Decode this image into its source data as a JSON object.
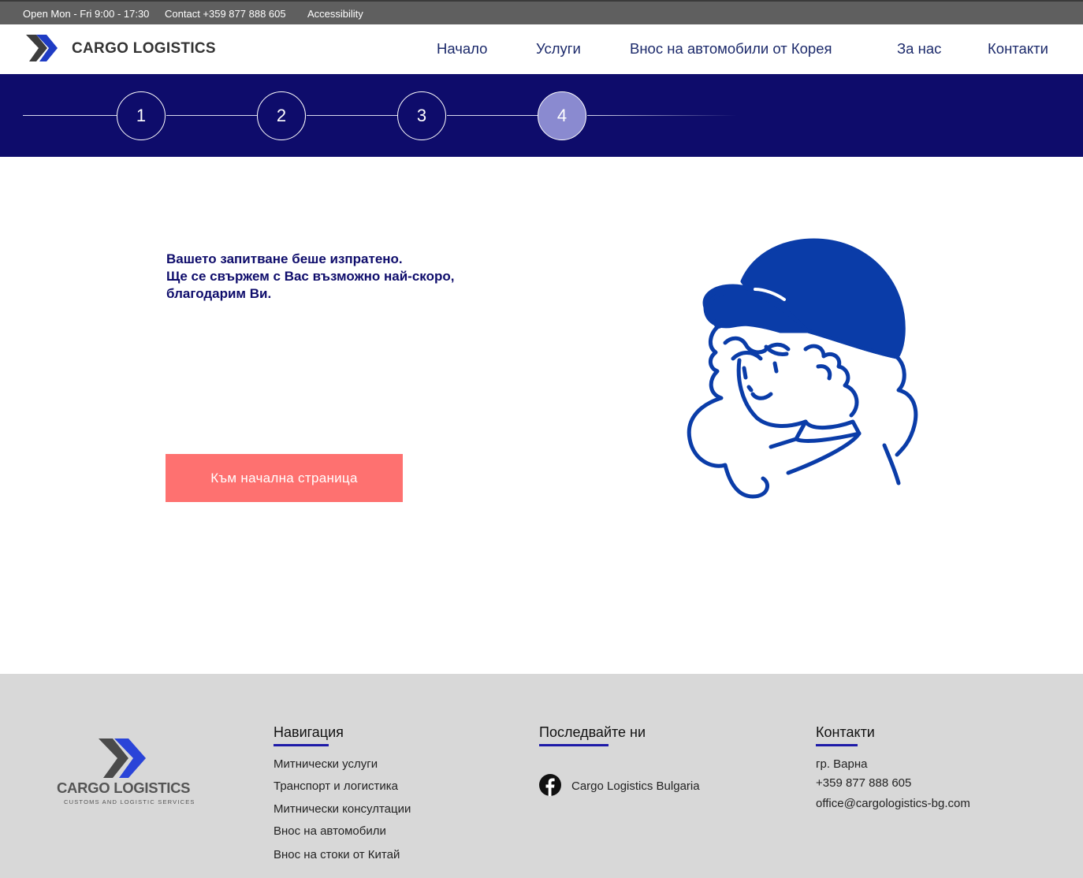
{
  "topbar": {
    "hours": "Open Mon - Fri 9:00 - 17:30",
    "contact": "Contact +359 877 888 605",
    "accessibility": "Accessibility"
  },
  "header": {
    "brand": "CARGO LOGISTICS",
    "nav": [
      "Начало",
      "Услуги",
      "Внос на автомобили от Корея",
      "За нас",
      "Контакти"
    ]
  },
  "stepper": {
    "steps": [
      "1",
      "2",
      "3",
      "4"
    ],
    "active_step": 4
  },
  "main": {
    "message_lines": [
      "Вашето запитване беше изпратено.",
      "Ще се свържем с Вас възможно най-скоро,",
      "благодарим Ви."
    ],
    "home_button": "Към начална страница"
  },
  "footer": {
    "logo_brand": "CARGO LOGISTICS",
    "logo_tagline": "CUSTOMS AND LOGISTIC SERVICES",
    "navigation": {
      "heading": "Навигация",
      "items": [
        "Митнически услуги",
        "Транспорт и логистика",
        "Митнически консултации",
        "Внос на автомобили",
        "Внос на стоки от Китай"
      ]
    },
    "follow": {
      "heading": "Последвайте ни",
      "facebook": "Cargo Logistics Bulgaria"
    },
    "contacts": {
      "heading": "Контакти",
      "city": "гр. Варна",
      "phone": "+359 877 888 605",
      "email": "office@cargologistics-bg.com"
    }
  },
  "colors": {
    "topbar": "#5f5f5f",
    "stepper_bg": "#0e0c6b",
    "active_step": "#8a8ad0",
    "button": "#fe7170",
    "illustration": "#0a3ca8",
    "footer_bg": "#d8d8d8"
  }
}
